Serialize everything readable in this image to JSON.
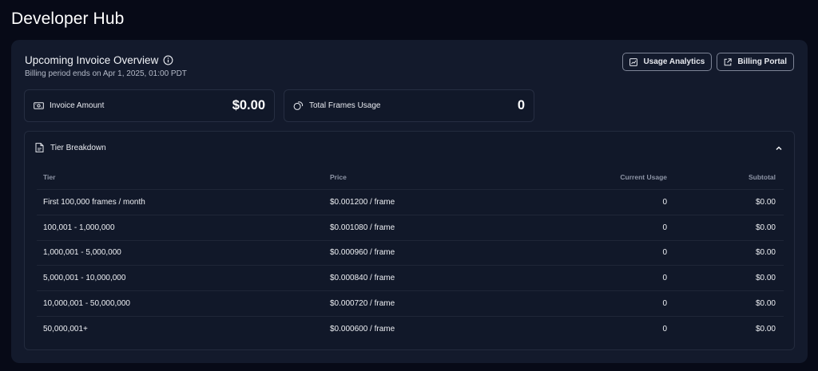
{
  "page": {
    "title": "Developer Hub"
  },
  "overview": {
    "title": "Upcoming Invoice Overview",
    "subtitle": "Billing period ends on Apr 1, 2025, 01:00 PDT",
    "actions": {
      "usage_analytics": "Usage Analytics",
      "billing_portal": "Billing Portal"
    }
  },
  "stats": {
    "invoice_amount": {
      "label": "Invoice Amount",
      "value": "$0.00",
      "icon": "money-icon"
    },
    "total_frames": {
      "label": "Total Frames Usage",
      "value": "0",
      "icon": "coins-icon"
    }
  },
  "tier_breakdown": {
    "title": "Tier Breakdown",
    "expanded": true,
    "columns": {
      "tier": "Tier",
      "price": "Price",
      "usage": "Current Usage",
      "subtotal": "Subtotal"
    },
    "rows": [
      {
        "tier": "First 100,000 frames / month",
        "price": "$0.001200 / frame",
        "usage": "0",
        "subtotal": "$0.00"
      },
      {
        "tier": "100,001 - 1,000,000",
        "price": "$0.001080 / frame",
        "usage": "0",
        "subtotal": "$0.00"
      },
      {
        "tier": "1,000,001 - 5,000,000",
        "price": "$0.000960 / frame",
        "usage": "0",
        "subtotal": "$0.00"
      },
      {
        "tier": "5,000,001 - 10,000,000",
        "price": "$0.000840 / frame",
        "usage": "0",
        "subtotal": "$0.00"
      },
      {
        "tier": "10,000,001 - 50,000,000",
        "price": "$0.000720 / frame",
        "usage": "0",
        "subtotal": "$0.00"
      },
      {
        "tier": "50,000,001+",
        "price": "$0.000600 / frame",
        "usage": "0",
        "subtotal": "$0.00"
      }
    ]
  },
  "colors": {
    "background": "#070a17",
    "panel": "#131a2c",
    "card": "#111829",
    "border": "#262e42"
  }
}
